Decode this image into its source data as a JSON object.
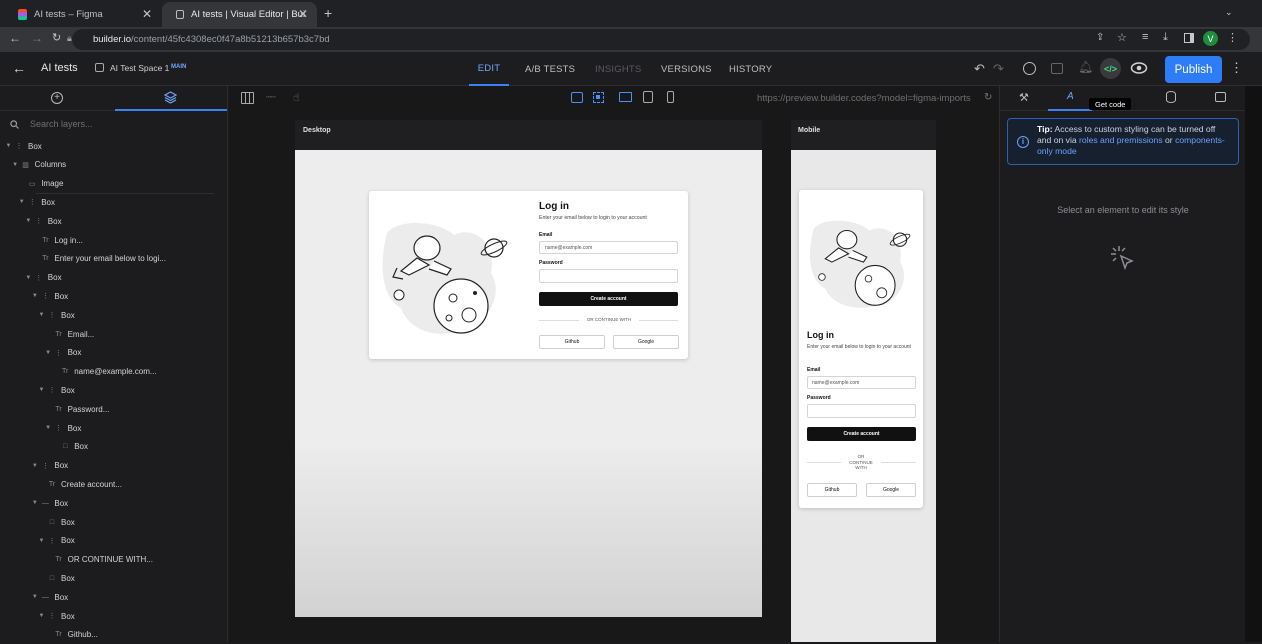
{
  "browser": {
    "tabs": [
      {
        "title": "AI tests – Figma",
        "active": false
      },
      {
        "title": "AI tests | Visual Editor | Builde",
        "active": true
      }
    ],
    "url_host": "builder.io",
    "url_path": "/content/45fc4308ec0f47a8b51213b657b3c7bd",
    "profile_initial": "V"
  },
  "app": {
    "title": "AI tests",
    "space": "AI Test Space 1",
    "space_badge": "MAIN",
    "nav": [
      {
        "label": "EDIT",
        "state": "active"
      },
      {
        "label": "A/B TESTS",
        "state": "normal"
      },
      {
        "label": "INSIGHTS",
        "state": "disabled"
      },
      {
        "label": "VERSIONS",
        "state": "normal"
      },
      {
        "label": "HISTORY",
        "state": "normal"
      }
    ],
    "publish_label": "Publish",
    "tooltip": "Get code"
  },
  "layers": {
    "search_placeholder": "Search layers...",
    "items": [
      {
        "label": "Box",
        "depth": 0,
        "icon": "box",
        "caret": true
      },
      {
        "label": "Columns",
        "depth": 1,
        "icon": "columns",
        "caret": true
      },
      {
        "label": "Image",
        "depth": 2,
        "icon": "image",
        "caret": false
      },
      {
        "label": "Box",
        "depth": 2,
        "icon": "box",
        "caret": true
      },
      {
        "label": "Box",
        "depth": 3,
        "icon": "box",
        "caret": true
      },
      {
        "label": "Log in...",
        "depth": 4,
        "icon": "text",
        "caret": false
      },
      {
        "label": "Enter your email below to logi...",
        "depth": 4,
        "icon": "text",
        "caret": false
      },
      {
        "label": "Box",
        "depth": 3,
        "icon": "box",
        "caret": true
      },
      {
        "label": "Box",
        "depth": 4,
        "icon": "box",
        "caret": true
      },
      {
        "label": "Box",
        "depth": 5,
        "icon": "box",
        "caret": true
      },
      {
        "label": "Email...",
        "depth": 6,
        "icon": "text",
        "caret": false
      },
      {
        "label": "Box",
        "depth": 6,
        "icon": "box",
        "caret": true
      },
      {
        "label": "name@example.com...",
        "depth": 7,
        "icon": "text",
        "caret": false
      },
      {
        "label": "Box",
        "depth": 5,
        "icon": "box",
        "caret": true
      },
      {
        "label": "Password...",
        "depth": 6,
        "icon": "text",
        "caret": false
      },
      {
        "label": "Box",
        "depth": 6,
        "icon": "box",
        "caret": true
      },
      {
        "label": "Box",
        "depth": 7,
        "icon": "square",
        "caret": false
      },
      {
        "label": "Box",
        "depth": 4,
        "icon": "box",
        "caret": true
      },
      {
        "label": "Create account...",
        "depth": 5,
        "icon": "text",
        "caret": false
      },
      {
        "label": "Box",
        "depth": 4,
        "icon": "dash",
        "caret": true
      },
      {
        "label": "Box",
        "depth": 5,
        "icon": "square",
        "caret": false
      },
      {
        "label": "Box",
        "depth": 5,
        "icon": "box",
        "caret": true
      },
      {
        "label": "OR CONTINUE WITH...",
        "depth": 6,
        "icon": "text",
        "caret": false
      },
      {
        "label": "Box",
        "depth": 5,
        "icon": "square",
        "caret": false
      },
      {
        "label": "Box",
        "depth": 4,
        "icon": "dash",
        "caret": true
      },
      {
        "label": "Box",
        "depth": 5,
        "icon": "box",
        "caret": true
      },
      {
        "label": "Github...",
        "depth": 6,
        "icon": "text",
        "caret": false
      }
    ]
  },
  "canvas": {
    "preview_url": "https://preview.builder.codes?model=figma-imports",
    "desktop_label": "Desktop",
    "mobile_label": "Mobile",
    "form": {
      "title": "Log in",
      "subtitle": "Enter your email below to login to your account",
      "email_label": "Email",
      "email_value": "name@example.com",
      "password_label": "Password",
      "submit": "Create account",
      "divider": "OR CONTINUE WITH",
      "mobile_divider": [
        "OR",
        "CONTINUE",
        "WITH"
      ],
      "github": "Github",
      "google": "Google"
    }
  },
  "style_panel": {
    "tip_bold": "Tip:",
    "tip_text": " Access to custom styling can be turned off and on via ",
    "tip_link1": "roles and premissions",
    "tip_or": " or ",
    "tip_link2": "components-only mode",
    "empty_message": "Select an element to edit its style"
  },
  "colors": {
    "accent": "#2e7cf6",
    "link": "#67a3ff",
    "profile": "#1e8e3e"
  }
}
